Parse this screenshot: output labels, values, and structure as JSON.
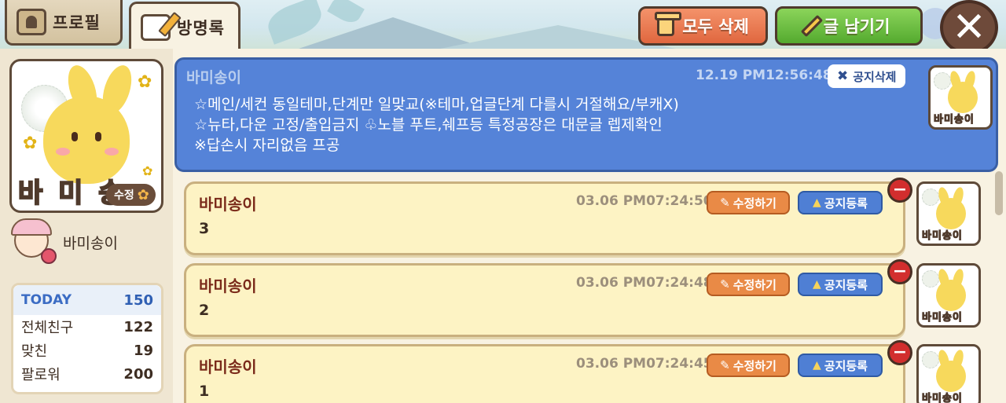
{
  "tabs": {
    "profile": "프로필",
    "guestbook": "방명록"
  },
  "toolbar": {
    "delete_all": "모두 삭제",
    "write": "글 남기기",
    "close": "✕"
  },
  "profile": {
    "avatar_name": "바 미 송 이",
    "edit_badge": "수정",
    "username": "바미송이"
  },
  "stats": {
    "today_label": "TODAY",
    "today_value": "150",
    "rows": [
      {
        "label": "전체친구",
        "value": "122"
      },
      {
        "label": "맞친",
        "value": "19"
      },
      {
        "label": "팔로워",
        "value": "200"
      }
    ]
  },
  "notice": {
    "author": "바미송이",
    "time": "12.19 PM12:56:48",
    "delete_label": "공지삭제",
    "lines": [
      "☆메인/세컨 동일테마,단계만 일맞교(※테마,업글단계 다를시 거절해요/부캐X)",
      "☆뉴타,다운 고정/출입금지 ♧노블 푸트,쉐프등 특정공장은 대문글 렙제확인",
      "※답손시 자리없음 프공"
    ],
    "thumb_name": "바미송이"
  },
  "posts": [
    {
      "author": "바미송이",
      "time": "03.06 PM07:24:50",
      "body": "3",
      "edit_label": "수정하기",
      "notice_label": "공지등록",
      "thumb_name": "바미송이"
    },
    {
      "author": "바미송이",
      "time": "03.06 PM07:24:48",
      "body": "2",
      "edit_label": "수정하기",
      "notice_label": "공지등록",
      "thumb_name": "바미송이"
    },
    {
      "author": "바미송이",
      "time": "03.06 PM07:24:45",
      "body": "1",
      "edit_label": "수정하기",
      "notice_label": "공지등록",
      "thumb_name": "바미송이"
    }
  ],
  "colors": {
    "notice_bg": "#5583d8",
    "post_bg": "#fdf3c4",
    "delete_btn": "#e0673f",
    "write_btn": "#54aa2f"
  }
}
